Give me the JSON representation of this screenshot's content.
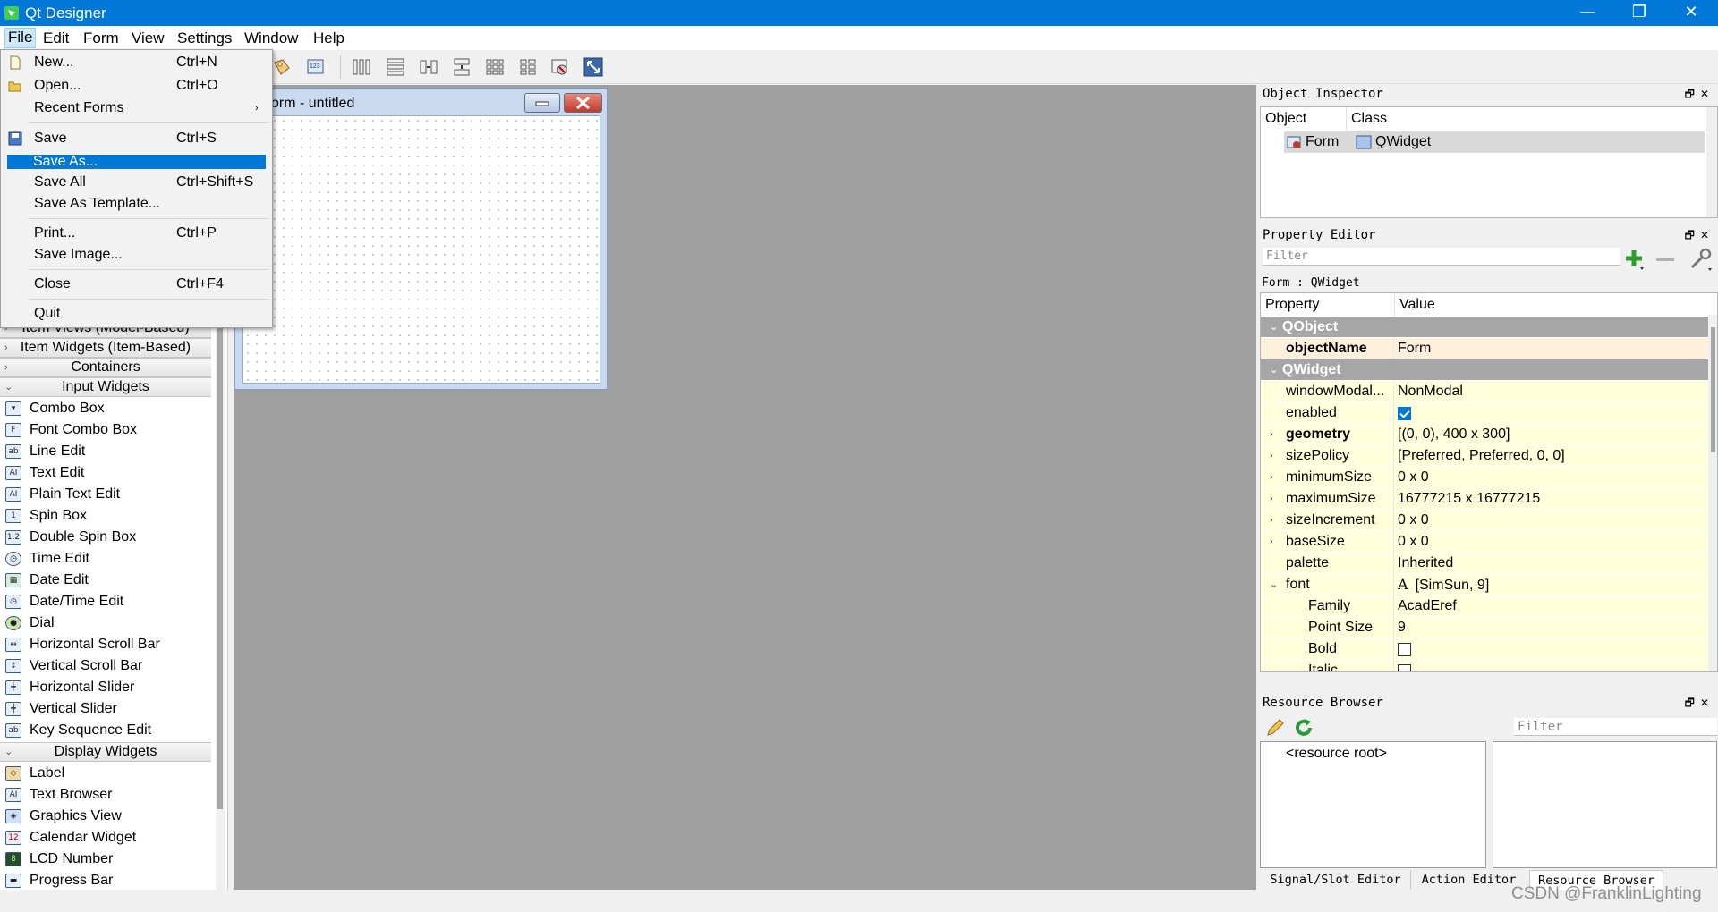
{
  "window": {
    "title": "Qt Designer",
    "minimize": "—",
    "restore": "❐",
    "close": "✕"
  },
  "menubar": [
    "File",
    "Edit",
    "Form",
    "View",
    "Settings",
    "Window",
    "Help"
  ],
  "file_menu": {
    "new": {
      "label": "New...",
      "shortcut": "Ctrl+N"
    },
    "open": {
      "label": "Open...",
      "shortcut": "Ctrl+O"
    },
    "recent": {
      "label": "Recent Forms",
      "submenu": "›"
    },
    "save": {
      "label": "Save",
      "shortcut": "Ctrl+S"
    },
    "save_as": {
      "label": "Save As..."
    },
    "save_all": {
      "label": "Save All",
      "shortcut": "Ctrl+Shift+S"
    },
    "save_template": {
      "label": "Save As Template..."
    },
    "print": {
      "label": "Print...",
      "shortcut": "Ctrl+P"
    },
    "save_image": {
      "label": "Save Image..."
    },
    "close": {
      "label": "Close",
      "shortcut": "Ctrl+F4"
    },
    "quit": {
      "label": "Quit"
    }
  },
  "form_window": {
    "title": "orm - untitled"
  },
  "widget_box": {
    "partial_top": "Item Views (Model-Based)",
    "categories": {
      "item_widgets": "Item Widgets (Item-Based)",
      "containers": "Containers",
      "input_widgets": "Input Widgets",
      "display_widgets": "Display Widgets"
    },
    "arrows": {
      "collapsed": "›",
      "expanded": "⌄"
    },
    "input_items": [
      "Combo Box",
      "Font Combo Box",
      "Line Edit",
      "Text Edit",
      "Plain Text Edit",
      "Spin Box",
      "Double Spin Box",
      "Time Edit",
      "Date Edit",
      "Date/Time Edit",
      "Dial",
      "Horizontal Scroll Bar",
      "Vertical Scroll Bar",
      "Horizontal Slider",
      "Vertical Slider",
      "Key Sequence Edit"
    ],
    "display_items": [
      "Label",
      "Text Browser",
      "Graphics View",
      "Calendar Widget",
      "LCD Number",
      "Progress Bar"
    ]
  },
  "object_inspector": {
    "title": "Object Inspector",
    "dock_buttons": "🗗✕",
    "col_object": "Object",
    "col_class": "Class",
    "row_object": "Form",
    "row_class": "QWidget"
  },
  "property_editor": {
    "title": "Property Editor",
    "dock_buttons": "🗗✕",
    "filter_placeholder": "Filter",
    "caption": "Form : QWidget",
    "col_property": "Property",
    "col_value": "Value",
    "rows": [
      {
        "name": "QObject",
        "group": true
      },
      {
        "name": "objectName",
        "value": "Form",
        "bold": true
      },
      {
        "name": "QWidget",
        "group": true
      },
      {
        "name": "windowModal...",
        "value": "NonModal"
      },
      {
        "name": "enabled",
        "check": true
      },
      {
        "name": "geometry",
        "value": "[(0, 0), 400 x 300]",
        "bold": true,
        "expand": "›"
      },
      {
        "name": "sizePolicy",
        "value": "[Preferred, Preferred, 0, 0]",
        "expand": "›"
      },
      {
        "name": "minimumSize",
        "value": "0 x 0",
        "expand": "›"
      },
      {
        "name": "maximumSize",
        "value": "16777215 x 16777215",
        "expand": "›"
      },
      {
        "name": "sizeIncrement",
        "value": "0 x 0",
        "expand": "›"
      },
      {
        "name": "baseSize",
        "value": "0 x 0",
        "expand": "›"
      },
      {
        "name": "palette",
        "value": "Inherited"
      },
      {
        "name": "font",
        "value": "[SimSun, 9]",
        "expand": "⌄",
        "fonticon": "A"
      },
      {
        "name": "Family",
        "value": "AcadEref",
        "sub": true
      },
      {
        "name": "Point Size",
        "value": "9",
        "sub": true
      },
      {
        "name": "Bold",
        "check": false,
        "sub": true
      },
      {
        "name": "Italic",
        "check": false,
        "sub": true
      }
    ]
  },
  "resource_browser": {
    "title": "Resource Browser",
    "dock_buttons": "🗗✕",
    "filter_placeholder": "Filter",
    "root": "<resource root>"
  },
  "bottom_tabs": [
    "Signal/Slot Editor",
    "Action Editor",
    "Resource Browser"
  ],
  "watermark": "CSDN @FranklinLighting",
  "colors": {
    "accent": "#0078d7",
    "group_header": "#a6a6a6",
    "row_yellow": "#ffffdc",
    "row_highlight": "#fff0dc"
  }
}
